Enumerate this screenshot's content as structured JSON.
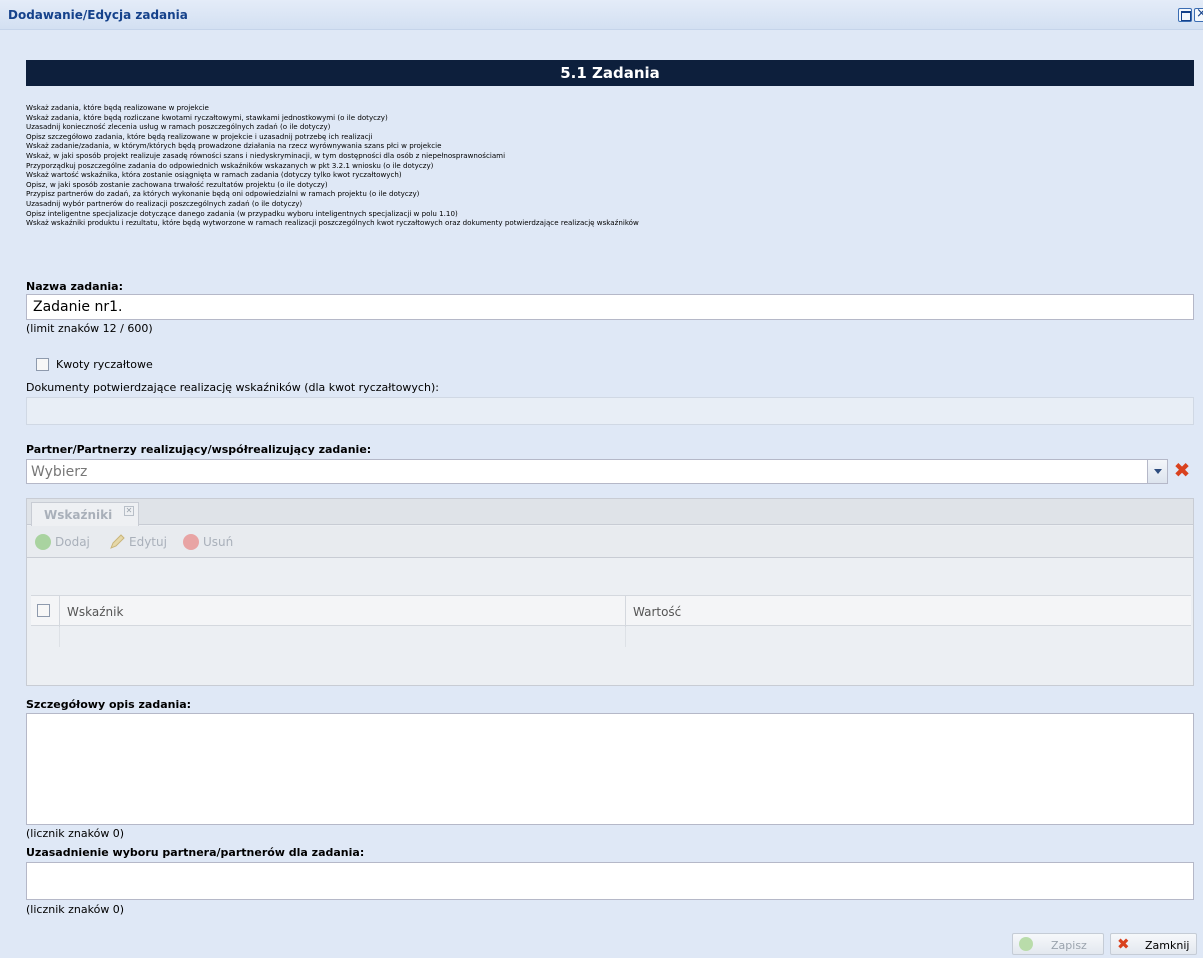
{
  "window": {
    "title": "Dodawanie/Edycja zadania"
  },
  "section": {
    "title": "5.1 Zadania"
  },
  "instructions": [
    "Wskaż zadania, które będą realizowane w projekcie",
    "Wskaż zadania, które będą rozliczane kwotami ryczałtowymi, stawkami jednostkowymi (o ile dotyczy)",
    "Uzasadnij konieczność zlecenia usług w ramach poszczególnych zadań (o ile dotyczy)",
    "Opisz szczegółowo zadania, które będą realizowane w projekcie i uzasadnij potrzebę ich realizacji",
    "Wskaż zadanie/zadania, w którym/których będą prowadzone działania na rzecz wyrównywania szans płci w projekcie",
    "Wskaż, w jaki sposób projekt realizuje zasadę równości szans i niedyskryminacji, w tym dostępności dla osób z niepełnosprawnościami",
    "Przyporządkuj poszczególne zadania do odpowiednich wskaźników wskazanych w pkt 3.2.1 wniosku (o ile dotyczy)",
    "Wskaż wartość wskaźnika, która zostanie osiągnięta w ramach zadania (dotyczy tylko kwot ryczałtowych)",
    "Opisz, w jaki sposób zostanie zachowana trwałość rezultatów projektu (o ile dotyczy)",
    "Przypisz partnerów do zadań, za których wykonanie będą oni odpowiedzialni w ramach projektu (o ile dotyczy)",
    "Uzasadnij wybór partnerów do realizacji poszczególnych zadań (o ile dotyczy)",
    "Opisz inteligentne specjalizacje dotyczące danego zadania (w przypadku wyboru inteligentnych specjalizacji w polu 1.10)",
    "Wskaż wskaźniki produktu i rezultatu, które będą wytworzone w ramach realizacji poszczególnych kwot ryczałtowych oraz dokumenty potwierdzające realizację wskaźników"
  ],
  "task_name": {
    "label": "Nazwa zadania:",
    "value": "Zadanie nr1.",
    "limit": "(limit znaków 12 / 600)"
  },
  "lump_sum": {
    "label": "Kwoty ryczałtowe",
    "checked": false
  },
  "documents": {
    "label": "Dokumenty potwierdzające realizację wskaźników (dla kwot ryczałtowych):"
  },
  "partners": {
    "label": "Partner/Partnerzy realizujący/współrealizujący zadanie:",
    "placeholder": "Wybierz"
  },
  "indicators": {
    "tab_label": "Wskaźniki",
    "toolbar": {
      "add": "Dodaj",
      "edit": "Edytuj",
      "delete": "Usuń"
    },
    "columns": [
      "Wskaźnik",
      "Wartość"
    ]
  },
  "description": {
    "label": "Szczegółowy opis zadania:",
    "counter": "(licznik znaków 0)"
  },
  "justification": {
    "label": "Uzasadnienie wyboru partnera/partnerów dla zadania:",
    "counter": "(licznik znaków 0)"
  },
  "buttons": {
    "save": "Zapisz",
    "close": "Zamknij"
  },
  "colors": {
    "header_bg": "#0d1f3c",
    "window_bg": "#dfe8f6",
    "title_text": "#15428b",
    "close_red": "#d9411e"
  }
}
